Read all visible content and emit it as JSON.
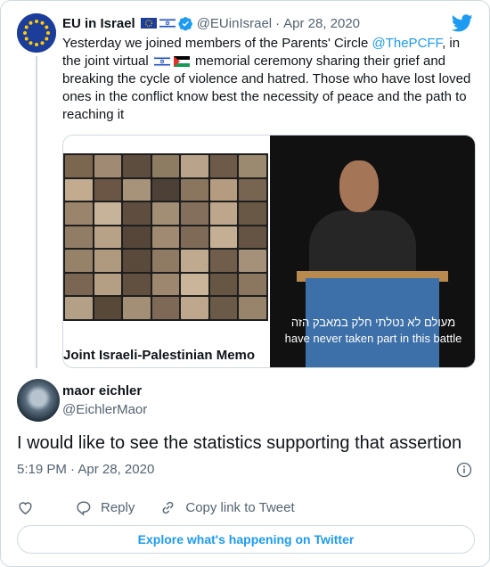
{
  "parent_tweet": {
    "name": "EU in Israel",
    "handle": "@EUinIsrael",
    "separator": "·",
    "date": "Apr 28, 2020",
    "text_before_link": "Yesterday we joined members of the Parents' Circle ",
    "link": "@ThePCFF",
    "text_after_link": ", in the joint virtual ",
    "text_after_flags": " memorial ceremony sharing their grief and breaking the cycle of violence and hatred. Those who have lost loved ones in the conflict know best the necessity of peace and the path to reaching it",
    "media_caption": "Joint Israeli-Palestinian Memo",
    "subtitle_he": "מעולם לא נטלתי חלק במאבק הזה",
    "subtitle_en": "have never taken part in this battle"
  },
  "reply": {
    "name": "maor eichler",
    "handle": "@EichlerMaor",
    "text": "I would like to see the statistics supporting that assertion",
    "time": "5:19 PM",
    "separator": "·",
    "date": "Apr 28, 2020"
  },
  "actions": {
    "reply_label": "Reply",
    "copy_label": "Copy link to Tweet"
  },
  "explore_label": "Explore what's happening on Twitter",
  "colors": {
    "accent": "#1d9bf0",
    "like_red": "#f91880",
    "muted": "#536471"
  },
  "icons": [
    "verified-icon",
    "twitter-logo-icon",
    "info-icon",
    "heart-icon",
    "reply-icon",
    "link-icon"
  ]
}
